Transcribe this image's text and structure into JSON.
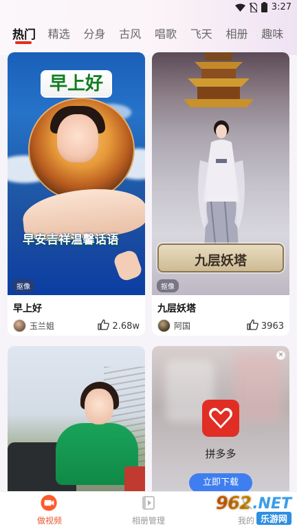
{
  "status_bar": {
    "time": "3:27",
    "icons": [
      "wifi-icon",
      "no-sim-icon",
      "battery-icon"
    ]
  },
  "tabs": [
    {
      "label": "热门",
      "active": true
    },
    {
      "label": "精选"
    },
    {
      "label": "分身"
    },
    {
      "label": "古风"
    },
    {
      "label": "唱歌"
    },
    {
      "label": "飞天"
    },
    {
      "label": "相册"
    },
    {
      "label": "趣味"
    }
  ],
  "cards": [
    {
      "image_text": "早上好",
      "image_caption": "早安吉祥温馨话语",
      "tag": "抠像",
      "title": "早上好",
      "author": "玉兰姐",
      "likes": "2.68w"
    },
    {
      "image_text": "九层妖塔",
      "tag": "抠像",
      "title": "九层妖塔",
      "author": "阿国",
      "likes": "3963"
    },
    {
      "ad_name": "拼多多",
      "ad_button": "立即下载",
      "close": "×"
    }
  ],
  "bottom_nav": [
    {
      "label": "做视频",
      "icon": "video-camera-icon",
      "active": true
    },
    {
      "label": "相册管理",
      "icon": "album-icon"
    },
    {
      "label": "我的",
      "icon": "profile-icon"
    }
  ],
  "watermark": {
    "number": "962",
    "net": ".NET",
    "sub": "乐游网"
  },
  "colors": {
    "accent_red": "#e52b1e",
    "nav_active": "#e8542a",
    "ad_button": "#3f7ef0",
    "pdd_red": "#e02e24"
  }
}
